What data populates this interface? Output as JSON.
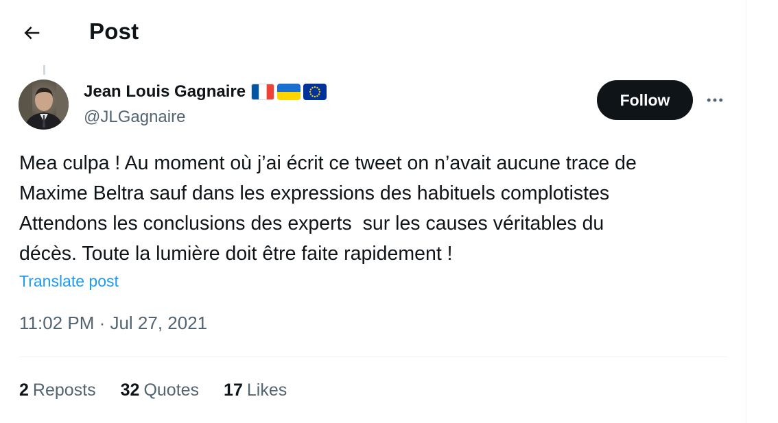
{
  "header": {
    "title": "Post",
    "back_icon": "arrow-left-icon"
  },
  "author": {
    "name": "Jean Louis Gagnaire",
    "handle": "@JLGagnaire",
    "flags": [
      "flag-france-icon",
      "flag-ukraine-icon",
      "flag-eu-icon"
    ]
  },
  "follow_button": {
    "label": "Follow"
  },
  "more_icon": "more-horizontal-icon",
  "post": {
    "text": "Mea culpa ! Au moment où j’ai écrit ce tweet on n’avait aucune trace de\nMaxime Beltra sauf dans les expressions des habituels complotistes\nAttendons les conclusions des experts  sur les causes véritables du\ndécès. Toute la lumière doit être faite rapidement !",
    "translate_label": "Translate post",
    "time": "11:02 PM",
    "separator": " · ",
    "date": "Jul 27, 2021"
  },
  "stats": {
    "reposts_count": "2",
    "reposts_label": "Reposts",
    "quotes_count": "32",
    "quotes_label": "Quotes",
    "likes_count": "17",
    "likes_label": "Likes"
  },
  "colors": {
    "text_primary": "#0f1419",
    "text_secondary": "#536471",
    "link": "#1d9bf0",
    "button_bg": "#0f1419",
    "border": "#eff3f4"
  }
}
